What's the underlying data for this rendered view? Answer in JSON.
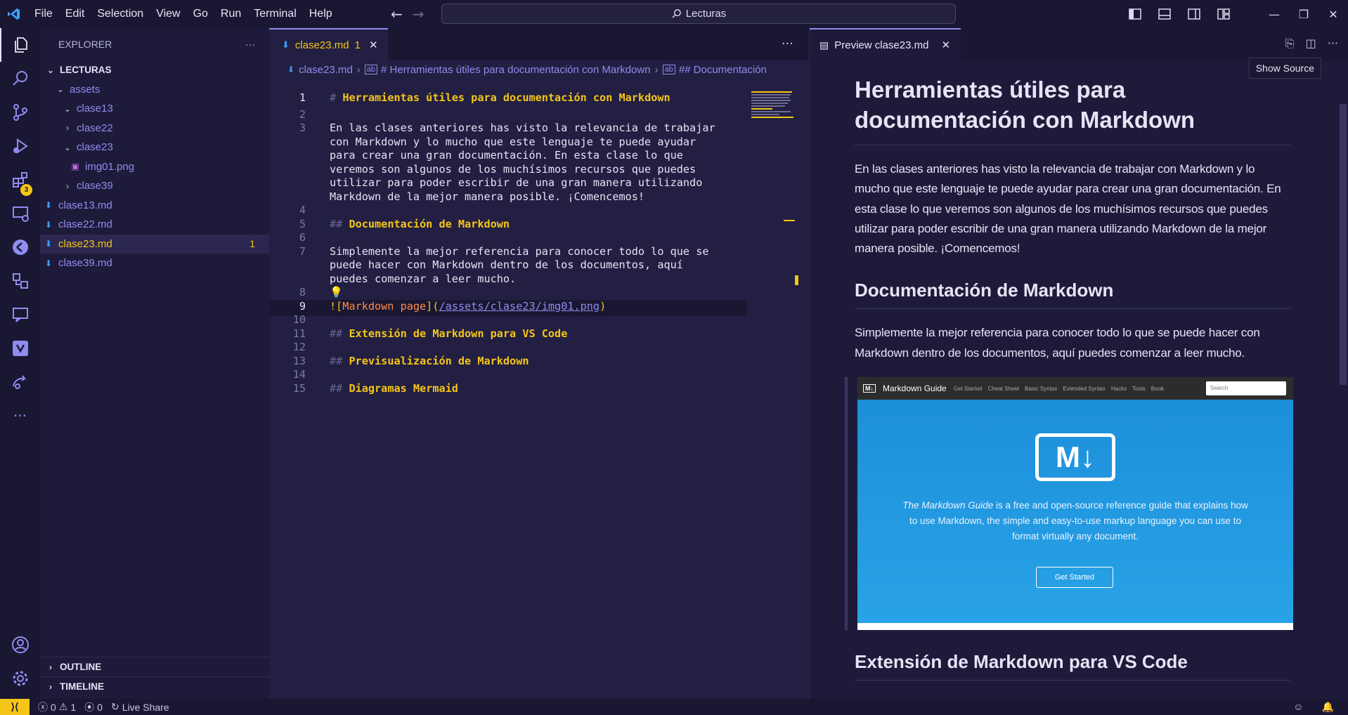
{
  "titlebar": {
    "menu": [
      "File",
      "Edit",
      "Selection",
      "View",
      "Go",
      "Run",
      "Terminal",
      "Help"
    ],
    "search_text": "Lecturas"
  },
  "activity_bar": {
    "extensions_badge": "3"
  },
  "explorer": {
    "title": "EXPLORER",
    "more": "···",
    "root": "LECTURAS",
    "items": [
      {
        "label": "assets",
        "type": "folder",
        "expanded": true
      },
      {
        "label": "clase13",
        "type": "folder",
        "expanded": true
      },
      {
        "label": "clase22",
        "type": "folder",
        "expanded": false
      },
      {
        "label": "clase23",
        "type": "folder",
        "expanded": true
      },
      {
        "label": "img01.png",
        "type": "image"
      },
      {
        "label": "clase39",
        "type": "folder",
        "expanded": false
      },
      {
        "label": "clase13.md",
        "type": "md"
      },
      {
        "label": "clase22.md",
        "type": "md"
      },
      {
        "label": "clase23.md",
        "type": "md",
        "selected": true,
        "count": "1"
      },
      {
        "label": "clase39.md",
        "type": "md"
      }
    ],
    "outline": "OUTLINE",
    "timeline": "TIMELINE"
  },
  "editor": {
    "tab_label": "clase23.md",
    "tab_count": "1",
    "more": "···",
    "breadcrumb": [
      "clase23.md",
      "# Herramientas útiles para documentación con Markdown",
      "## Documentación"
    ],
    "lines": {
      "l1_hash": "#",
      "l1_text": "Herramientas útiles para documentación con Markdown",
      "l3_a": "En las clases anteriores has visto la relevancia de trabajar",
      "l3_b": "con Markdown y lo mucho que este lenguaje te puede ayudar",
      "l3_c": "para crear una gran documentación. En esta clase lo que",
      "l3_d": "veremos son algunos de los muchísimos recursos que puedes",
      "l3_e": "utilizar para poder escribir de una gran manera utilizando",
      "l3_f": "Markdown de la mejor manera posible. ¡Comencemos!",
      "l5_hash": "##",
      "l5_text": "Documentación de Markdown",
      "l7_a": "Simplemente la mejor referencia para conocer todo lo que se",
      "l7_b": "puede hacer con Markdown dentro de los documentos, aquí",
      "l7_c": "puedes comenzar a leer mucho.",
      "l9_a": "![",
      "l9_b": "Markdown page",
      "l9_c": "](",
      "l9_d": "/assets/clase23/img01.png",
      "l9_e": ")",
      "l11_hash": "##",
      "l11_text": "Extensión de Markdown para VS Code",
      "l13_hash": "##",
      "l13_text": "Previsualización de Markdown",
      "l15_hash": "##",
      "l15_text": "Diagramas Mermaid"
    },
    "line_numbers": [
      "1",
      "2",
      "3",
      "4",
      "5",
      "6",
      "7",
      "8",
      "9",
      "10",
      "11",
      "12",
      "13",
      "14",
      "15"
    ]
  },
  "preview": {
    "tab_label": "Preview clase23.md",
    "tooltip": "Show Source",
    "h1": "Herramientas útiles para documentación con Markdown",
    "p1": "En las clases anteriores has visto la relevancia de trabajar con Markdown y lo mucho que este lenguaje te puede ayudar para crear una gran documentación. En esta clase lo que veremos son algunos de los muchísimos recursos que puedes utilizar para poder escribir de una gran manera utilizando Markdown de la mejor manera posible. ¡Comencemos!",
    "h2_a": "Documentación de Markdown",
    "p2": "Simplemente la mejor referencia para conocer todo lo que se puede hacer con Markdown dentro de los documentos, aquí puedes comenzar a leer mucho.",
    "image": {
      "site_name": "Markdown Guide",
      "nav": [
        "Get Started",
        "Cheat Sheet",
        "Basic Syntax",
        "Extended Syntax",
        "Hacks",
        "Tools",
        "Book"
      ],
      "search_placeholder": "Search",
      "logo_text": "M↓",
      "desc_em": "The Markdown Guide",
      "desc_rest": " is a free and open-source reference guide that explains how to use Markdown, the simple and easy-to-use markup language you can use to format virtually any document.",
      "button": "Get Started"
    },
    "h2_b": "Extensión de Markdown para VS Code"
  },
  "statusbar": {
    "errors": "0",
    "warnings": "1",
    "ports": "0",
    "live_share": "Live Share"
  },
  "colors": {
    "accent": "#8f8cf0",
    "warning": "#f5c518",
    "background": "#1e1b3a",
    "md_blue": "#3ba0ff"
  }
}
